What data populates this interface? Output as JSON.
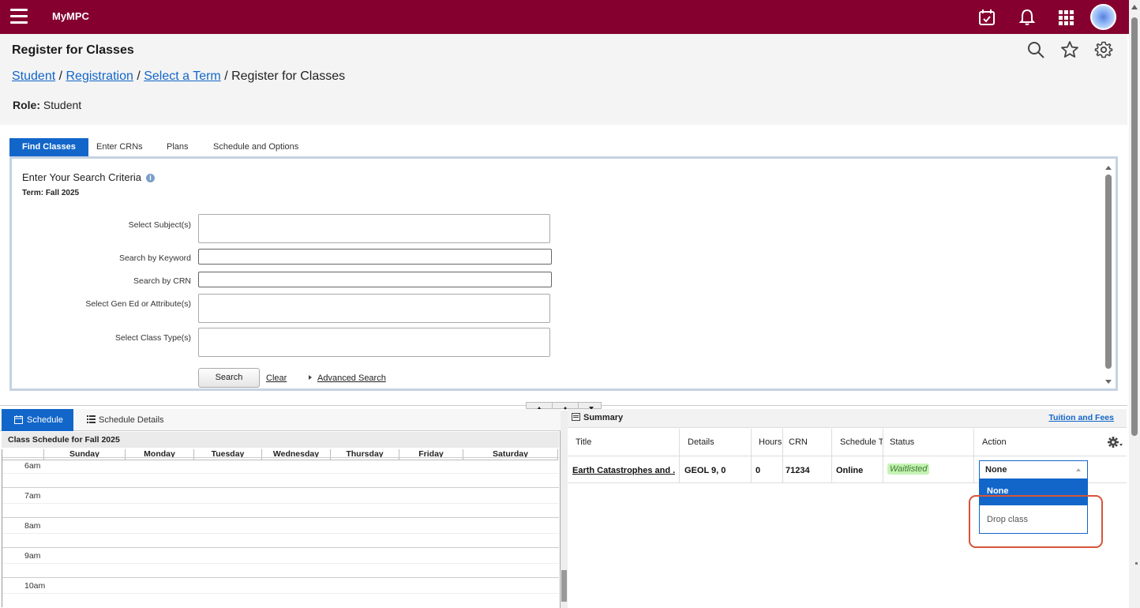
{
  "app": {
    "brand": "MyMPC"
  },
  "header": {
    "page_title": "Register for Classes",
    "breadcrumb": [
      {
        "label": "Student"
      },
      {
        "label": "Registration"
      },
      {
        "label": "Select a Term"
      }
    ],
    "breadcrumb_current": "Register for Classes",
    "breadcrumb_separator": " / ",
    "role_label": "Role:",
    "role_value": "Student"
  },
  "tabs": [
    {
      "label": "Find Classes",
      "active": true
    },
    {
      "label": "Enter CRNs"
    },
    {
      "label": "Plans"
    },
    {
      "label": "Schedule and Options"
    }
  ],
  "search": {
    "title": "Enter Your Search Criteria",
    "info_icon": "info-icon",
    "term": "Term: Fall 2025",
    "fields": {
      "subject": "Select Subject(s)",
      "keyword": "Search by Keyword",
      "crn": "Search by CRN",
      "gened": "Select Gen Ed or Attribute(s)",
      "classtype": "Select Class Type(s)"
    },
    "search_button": "Search",
    "clear_link": "Clear",
    "advanced_link": "Advanced Search"
  },
  "schedule": {
    "tab_schedule": "Schedule",
    "tab_details": "Schedule Details",
    "caption": "Class Schedule for Fall 2025",
    "days": [
      "Sunday",
      "Monday",
      "Tuesday",
      "Wednesday",
      "Thursday",
      "Friday",
      "Saturday"
    ],
    "times": [
      "6am",
      "7am",
      "8am",
      "9am",
      "10am"
    ]
  },
  "summary": {
    "title": "Summary",
    "tuition_link": "Tuition and Fees",
    "columns": {
      "title": "Title",
      "details": "Details",
      "hours": "Hours",
      "crn": "CRN",
      "schedule_type": "Schedule T",
      "status": "Status",
      "action": "Action"
    },
    "row": {
      "title": "Earth Catastrophes and ...",
      "details": "GEOL 9, 0",
      "hours": "0",
      "crn": "71234",
      "schedule_type": "Online",
      "status": "Waitlisted"
    },
    "action_selected": "None",
    "action_options": [
      "None",
      "Drop class"
    ]
  },
  "colors": {
    "brand": "#85002f",
    "accent": "#1266c9",
    "waitlisted_bg": "#c5f3b4",
    "highlight": "#d9533a"
  }
}
